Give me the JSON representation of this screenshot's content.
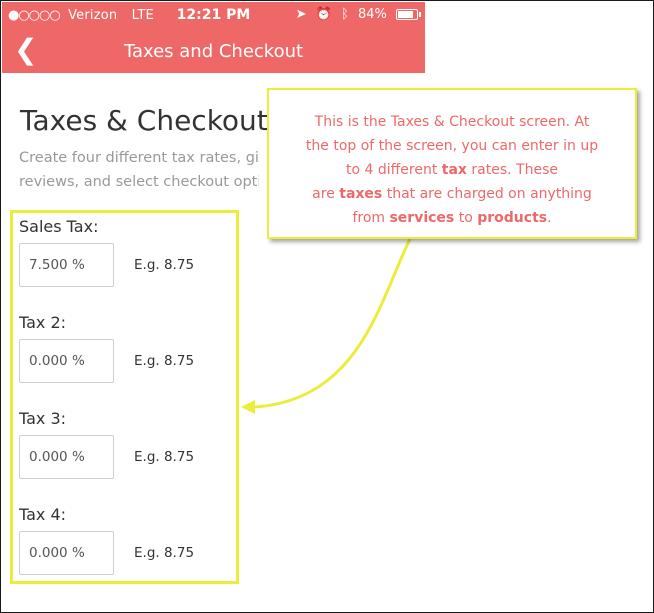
{
  "status_bar": {
    "signal": "●○○○○",
    "carrier": "Verizon",
    "network": "LTE",
    "time": "12:21 PM",
    "battery": "84%"
  },
  "nav": {
    "back_label": "❮",
    "title": "Taxes and Checkout"
  },
  "page": {
    "title": "Taxes & Checkout",
    "description_line1": "Create four different tax rates, giv",
    "description_line2": "reviews, and select checkout optio"
  },
  "taxes": [
    {
      "label": "Sales Tax:",
      "value": "7.500 %",
      "example": "E.g. 8.75"
    },
    {
      "label": "Tax 2:",
      "value": "0.000 %",
      "example": "E.g. 8.75"
    },
    {
      "label": "Tax 3:",
      "value": "0.000 %",
      "example": "E.g. 8.75"
    },
    {
      "label": "Tax 4:",
      "value": "0.000 %",
      "example": "E.g. 8.75"
    }
  ],
  "callout": {
    "line1": "This is the Taxes & Checkout screen. At",
    "line2": "the top of the screen, you can enter in up",
    "line3_a": "to 4 different ",
    "line3_b": "tax",
    "line3_c": " rates. These",
    "line4_a": "are ",
    "line4_b": "taxes",
    "line4_c": " that are charged on anything",
    "line5_a": "from ",
    "line5_b": "services",
    "line5_c": " to ",
    "line5_d": "products",
    "line5_e": "."
  },
  "colors": {
    "header": "#ef6868",
    "highlight": "#ecec3c",
    "callout_text": "#ef6868"
  }
}
